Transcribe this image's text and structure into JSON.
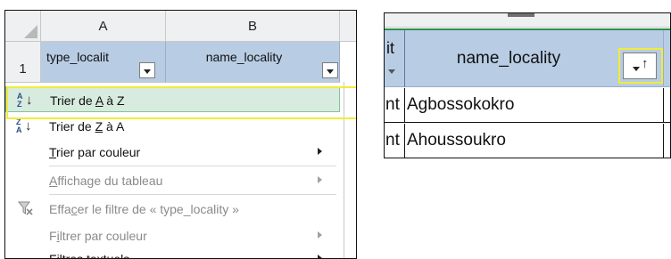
{
  "left": {
    "columns": [
      "A",
      "B"
    ],
    "row_number": "1",
    "header_cells": [
      "type_localit",
      "name_locality"
    ],
    "menu": [
      {
        "label": "Trier de A à Z",
        "mnemonic_index": 9,
        "icon": "sort-a-to-z-icon",
        "active": true,
        "disabled": false,
        "submenu": false
      },
      {
        "label": "Trier de Z à A",
        "mnemonic_index": 9,
        "icon": "sort-z-to-a-icon",
        "active": false,
        "disabled": false,
        "submenu": false
      },
      {
        "label": "Trier par couleur",
        "mnemonic_index": 0,
        "icon": "",
        "active": false,
        "disabled": false,
        "submenu": true
      },
      {
        "label": "Affichage du tableau",
        "mnemonic_index": 0,
        "icon": "",
        "active": false,
        "disabled": true,
        "submenu": true
      },
      {
        "label": "Effacer le filtre de « type_locality »",
        "mnemonic_index": 4,
        "icon": "clear-filter-icon",
        "active": false,
        "disabled": true,
        "submenu": false
      },
      {
        "label": "Filtrer par couleur",
        "mnemonic_index": 1,
        "icon": "",
        "active": false,
        "disabled": true,
        "submenu": true
      },
      {
        "label": "Filtres textuels",
        "mnemonic_index": 0,
        "icon": "",
        "active": false,
        "disabled": false,
        "submenu": true
      }
    ]
  },
  "right": {
    "left_header_fragment": "it",
    "header_title": "name_locality",
    "rows": [
      {
        "left_fragment": "nt",
        "name": "Agbossokokro"
      },
      {
        "left_fragment": "nt",
        "name": "Ahoussoukro"
      }
    ]
  },
  "colors": {
    "header_fill": "#b8cce4",
    "active_item": "#d7ecdf",
    "highlight": "#f0ec3a"
  }
}
